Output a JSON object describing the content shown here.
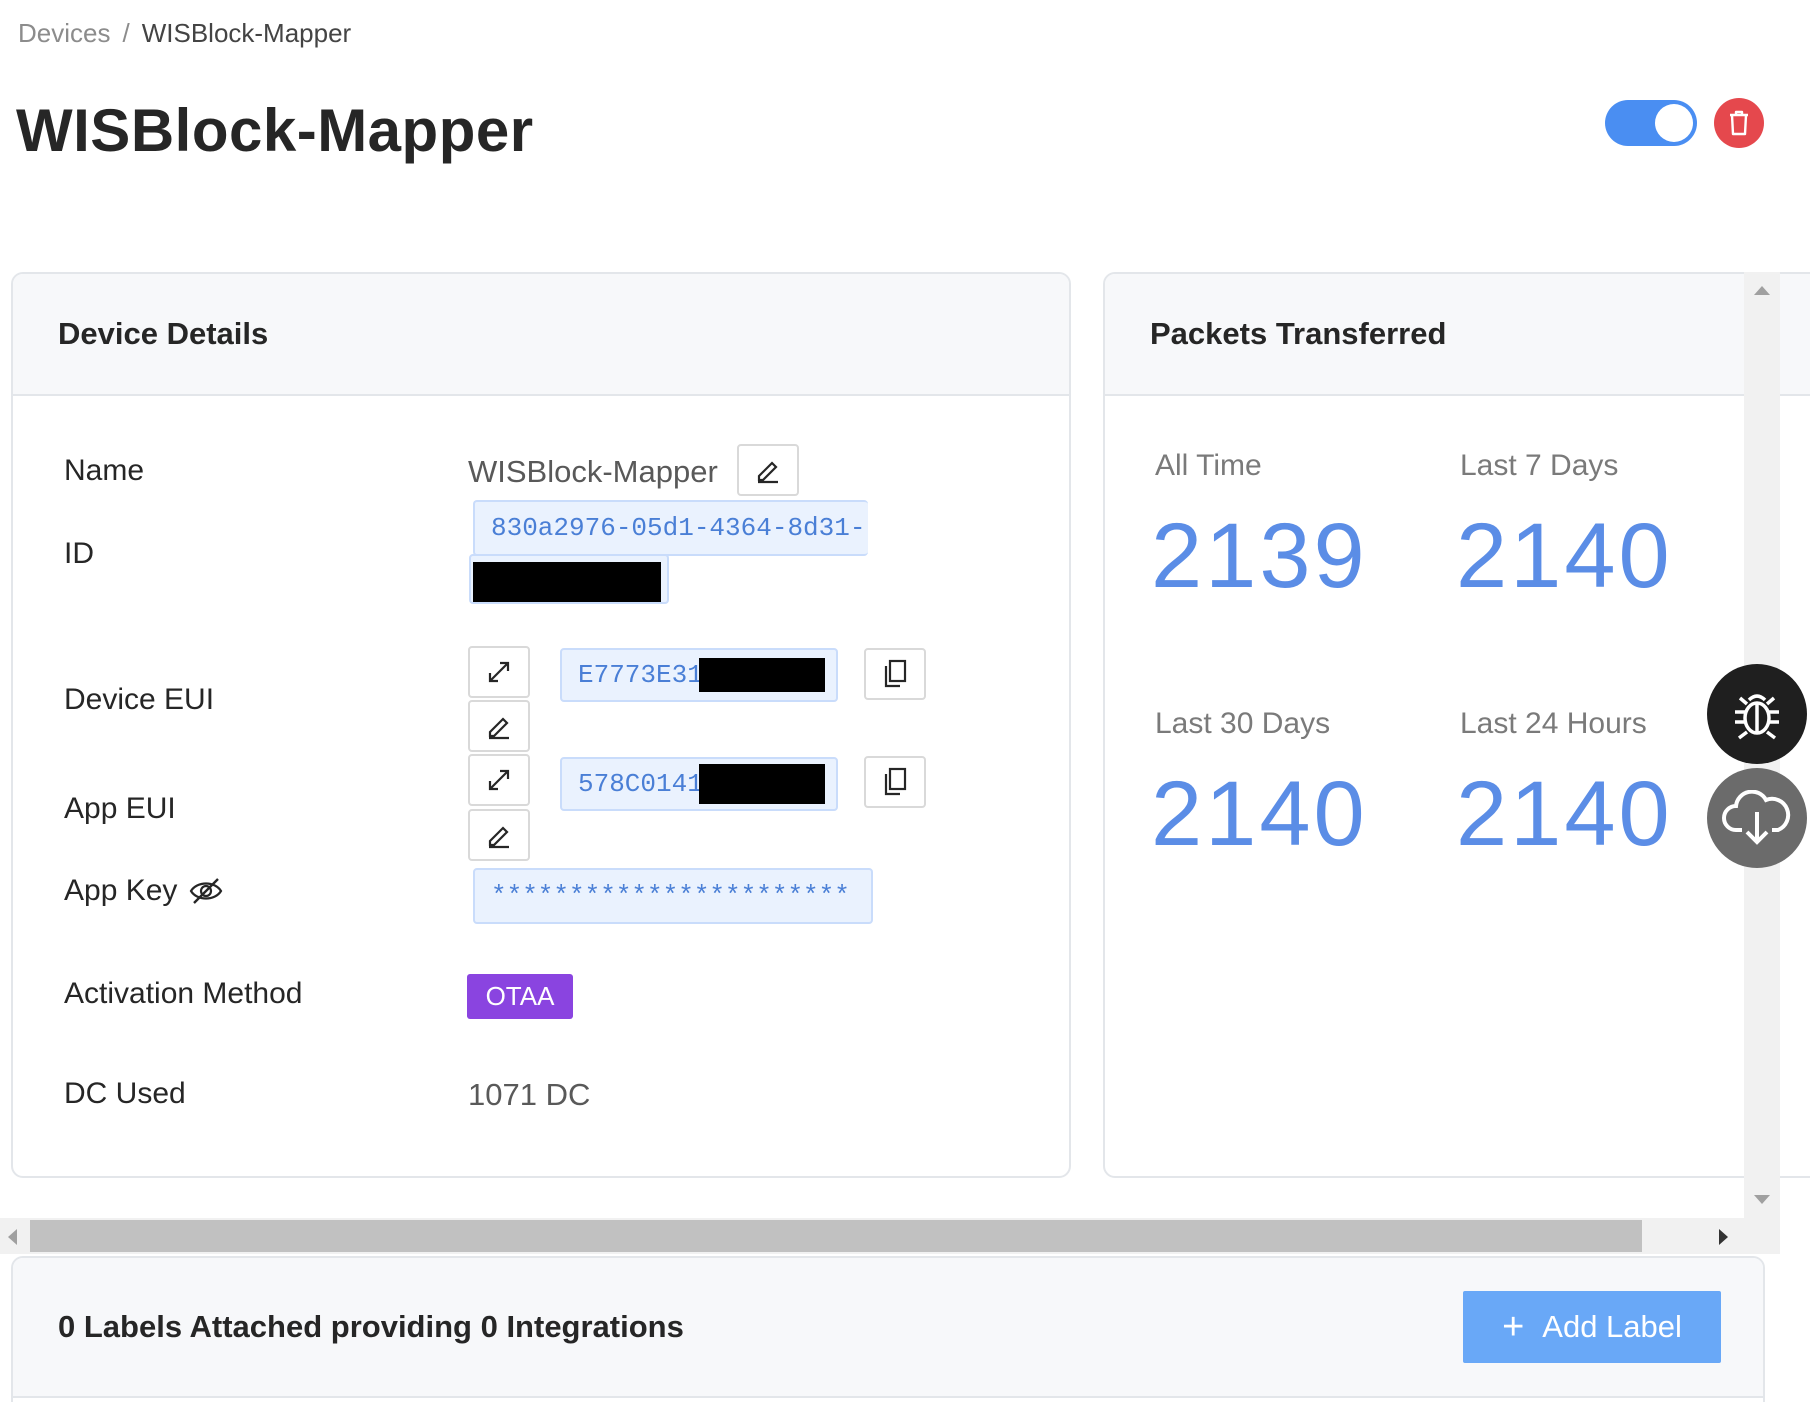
{
  "breadcrumb": {
    "parent": "Devices",
    "separator": "/",
    "current": "WISBlock-Mapper"
  },
  "page": {
    "title": "WISBlock-Mapper"
  },
  "header_controls": {
    "active_toggle_on": true
  },
  "device_details": {
    "title": "Device Details",
    "rows": {
      "name": {
        "label": "Name",
        "value": "WISBlock-Mapper"
      },
      "id": {
        "label": "ID",
        "value": "830a2976-05d1-4364-8d31-"
      },
      "device_eui": {
        "label": "Device EUI",
        "value": "E7773E31"
      },
      "app_eui": {
        "label": "App EUI",
        "value": "578C0141"
      },
      "app_key": {
        "label": "App Key",
        "value": "***********************"
      },
      "activation": {
        "label": "Activation Method",
        "value": "OTAA"
      },
      "dc_used": {
        "label": "DC Used",
        "value": "1071 DC"
      }
    }
  },
  "packets": {
    "title": "Packets Transferred",
    "stats": [
      {
        "label": "All Time",
        "value": "2139"
      },
      {
        "label": "Last 7 Days",
        "value": "2140"
      },
      {
        "label": "Last 30 Days",
        "value": "2140"
      },
      {
        "label": "Last 24 Hours",
        "value": "2140"
      }
    ]
  },
  "labels_section": {
    "title": "0 Labels Attached providing 0 Integrations",
    "add_button": "Add Label",
    "add_icon": "+"
  },
  "colors": {
    "accent": "#4a8ef2",
    "stat": "#5b8de6",
    "danger": "#e5484d",
    "otaa": "#8a44e0"
  }
}
